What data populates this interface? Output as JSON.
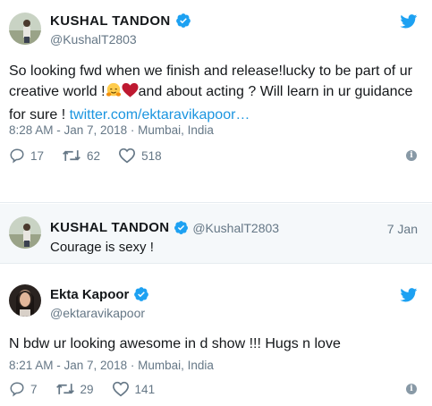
{
  "tweet1": {
    "name": "KUSHAL TANDON",
    "handle": "@KushalT2803",
    "text_part1": "So looking fwd when we finish and release!lucky to be part of ur creative world !",
    "text_part2": "and about acting ? Will learn in ur guidance for sure ! ",
    "link": "twitter.com/ektaravikapoor…",
    "meta": "8:28 AM - Jan 7, 2018 · Mumbai, India",
    "replies": "17",
    "retweets": "62",
    "likes": "518"
  },
  "quoted": {
    "name": "KUSHAL TANDON",
    "handle": "@KushalT2803",
    "date": "7 Jan",
    "text": "Courage is sexy !"
  },
  "tweet2": {
    "name": "Ekta Kapoor",
    "handle": "@ektaravikapoor",
    "text": "N bdw ur looking awesome in d show !!! Hugs n love",
    "meta": "8:21 AM - Jan 7, 2018 · Mumbai, India",
    "replies": "7",
    "retweets": "29",
    "likes": "141"
  },
  "colors": {
    "text": "#14171a",
    "muted": "#657786",
    "link": "#1b95e0",
    "verified": "#1da1f2",
    "heart": "#e0245e"
  },
  "icons": [
    "verified-badge-icon",
    "twitter-bird-icon",
    "reply-icon",
    "retweet-icon",
    "like-icon",
    "info-icon",
    "hugging-face-emoji",
    "red-heart-emoji"
  ]
}
